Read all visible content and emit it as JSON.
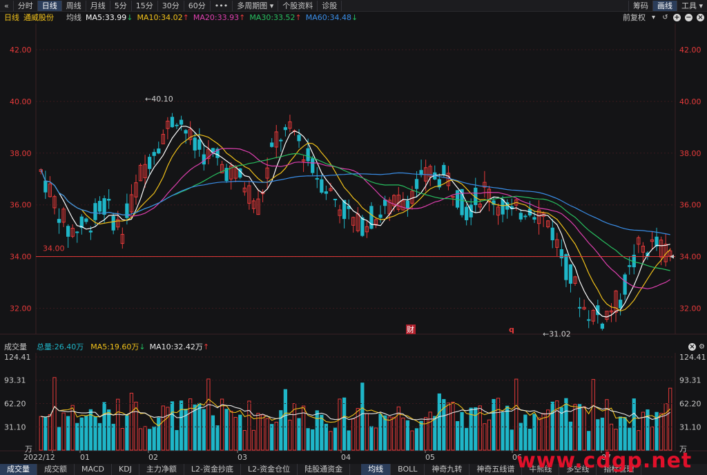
{
  "toolbar": {
    "back_icon": "double-chevron-left",
    "left_items": [
      "分时",
      "日线",
      "周线",
      "月线",
      "5分",
      "15分",
      "30分",
      "60分",
      "•••",
      "多周期图",
      "个股资料",
      "诊股"
    ],
    "active_index": 1,
    "right_items": [
      "筹码",
      "画线",
      "工具"
    ],
    "right_active_index": 1
  },
  "info": {
    "period": "日线",
    "stock": "通威股份",
    "avg_label": "均线",
    "ma5": "MA5:33.99",
    "ma10": "MA10:34.02",
    "ma20": "MA20:33.93",
    "ma30": "MA30:33.52",
    "ma60": "MA60:34.48",
    "fq_label": "前复权"
  },
  "volume_info": {
    "title": "成交量",
    "total": "总量:26.40万",
    "ma5": "MA5:19.60万",
    "ma10": "MA10:32.42万"
  },
  "tabs": [
    "成交量",
    "成交额",
    "MACD",
    "KDJ",
    "主力净额",
    "L2-资金抄底",
    "L2-资金仓位",
    "陆股通资金",
    "均线",
    "BOLL",
    "神奇九转",
    "神奇五线谱",
    "牛熊线",
    "多空线",
    "指标管理"
  ],
  "tabs_active": [
    0,
    8
  ],
  "watermark": "www.cdgp.net",
  "colors": {
    "up": "#e83a3a",
    "down": "#1fb6c8",
    "ma5": "#ffffff",
    "ma10": "#f2c21a",
    "ma20": "#e040b0",
    "ma30": "#28c060",
    "ma60": "#3a8ee8",
    "grid": "#3a1a1e",
    "bg": "#141416"
  },
  "chart_data": [
    {
      "type": "candlestick",
      "y_ticks": [
        "42.00",
        "40.00",
        "38.00",
        "36.00",
        "34.00",
        "32.00"
      ],
      "x_labels": [
        "2022/12",
        "01",
        "02",
        "03",
        "04",
        "05",
        "06",
        "07"
      ],
      "ylim": [
        31,
        42.8
      ],
      "high_mark": "←40.10",
      "low_mark": "←31.02",
      "ref_line_label": "34.00",
      "events": [
        "财",
        "q"
      ],
      "ma_values": {
        "ma5": 33.99,
        "ma10": 34.02,
        "ma20": 33.93,
        "ma30": 33.52,
        "ma60": 34.48
      }
    },
    {
      "type": "bar",
      "title": "成交量",
      "y_ticks": [
        "124.41",
        "93.31",
        "62.20",
        "31.10",
        "万"
      ],
      "ylim": [
        0,
        124.41
      ],
      "unit": "万"
    }
  ]
}
